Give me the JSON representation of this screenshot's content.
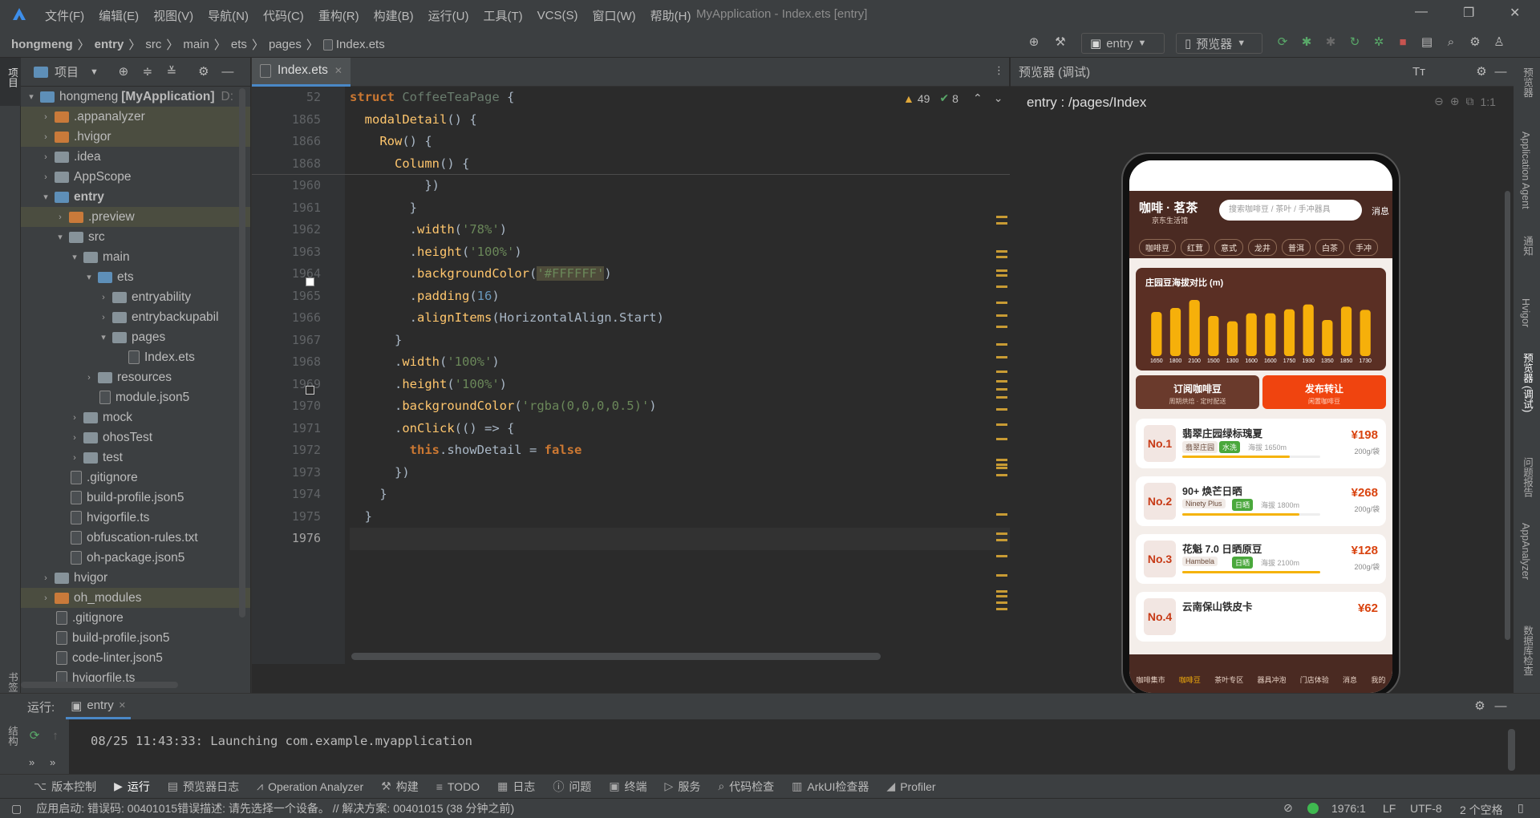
{
  "menu": [
    "文件(F)",
    "编辑(E)",
    "视图(V)",
    "导航(N)",
    "代码(C)",
    "重构(R)",
    "构建(B)",
    "运行(U)",
    "工具(T)",
    "VCS(S)",
    "窗口(W)",
    "帮助(H)"
  ],
  "window_title": "MyApplication - Index.ets [entry]",
  "breadcrumb": [
    "hongmeng",
    "entry",
    "src",
    "main",
    "ets",
    "pages",
    "Index.ets"
  ],
  "toolbar": {
    "run_config": "entry",
    "device": "预览器"
  },
  "project": {
    "header": "项目",
    "items": [
      {
        "label": "hongmeng",
        "suffix": "[MyApplication]",
        "hint": "D:",
        "depth": 0,
        "arrow": "▾",
        "kind": "folder-blue"
      },
      {
        "label": ".appanalyzer",
        "depth": 1,
        "arrow": "›",
        "kind": "folder-orange",
        "sel": true
      },
      {
        "label": ".hvigor",
        "depth": 1,
        "arrow": "›",
        "kind": "folder-orange",
        "sel": true
      },
      {
        "label": ".idea",
        "depth": 1,
        "arrow": "›",
        "kind": "folder"
      },
      {
        "label": "AppScope",
        "depth": 1,
        "arrow": "›",
        "kind": "folder"
      },
      {
        "label": "entry",
        "depth": 1,
        "arrow": "▾",
        "kind": "folder-blue",
        "bold": true
      },
      {
        "label": ".preview",
        "depth": 2,
        "arrow": "›",
        "kind": "folder-orange",
        "sel": true
      },
      {
        "label": "src",
        "depth": 2,
        "arrow": "▾",
        "kind": "folder"
      },
      {
        "label": "main",
        "depth": 3,
        "arrow": "▾",
        "kind": "folder"
      },
      {
        "label": "ets",
        "depth": 4,
        "arrow": "▾",
        "kind": "folder-blue"
      },
      {
        "label": "entryability",
        "depth": 5,
        "arrow": "›",
        "kind": "folder"
      },
      {
        "label": "entrybackupabil",
        "depth": 5,
        "arrow": "›",
        "kind": "folder"
      },
      {
        "label": "pages",
        "depth": 5,
        "arrow": "▾",
        "kind": "folder"
      },
      {
        "label": "Index.ets",
        "depth": 6,
        "arrow": "",
        "kind": "file"
      },
      {
        "label": "resources",
        "depth": 4,
        "arrow": "›",
        "kind": "folder"
      },
      {
        "label": "module.json5",
        "depth": 4,
        "arrow": "",
        "kind": "file"
      },
      {
        "label": "mock",
        "depth": 3,
        "arrow": "›",
        "kind": "folder"
      },
      {
        "label": "ohosTest",
        "depth": 3,
        "arrow": "›",
        "kind": "folder"
      },
      {
        "label": "test",
        "depth": 3,
        "arrow": "›",
        "kind": "folder"
      },
      {
        "label": ".gitignore",
        "depth": 2,
        "arrow": "",
        "kind": "file"
      },
      {
        "label": "build-profile.json5",
        "depth": 2,
        "arrow": "",
        "kind": "file"
      },
      {
        "label": "hvigorfile.ts",
        "depth": 2,
        "arrow": "",
        "kind": "file"
      },
      {
        "label": "obfuscation-rules.txt",
        "depth": 2,
        "arrow": "",
        "kind": "file"
      },
      {
        "label": "oh-package.json5",
        "depth": 2,
        "arrow": "",
        "kind": "file"
      },
      {
        "label": "hvigor",
        "depth": 1,
        "arrow": "›",
        "kind": "folder"
      },
      {
        "label": "oh_modules",
        "depth": 1,
        "arrow": "›",
        "kind": "folder-orange",
        "sel": true
      },
      {
        "label": ".gitignore",
        "depth": 1,
        "arrow": "",
        "kind": "file"
      },
      {
        "label": "build-profile.json5",
        "depth": 1,
        "arrow": "",
        "kind": "file"
      },
      {
        "label": "code-linter.json5",
        "depth": 1,
        "arrow": "",
        "kind": "file"
      },
      {
        "label": "hvigorfile.ts",
        "depth": 1,
        "arrow": "",
        "kind": "file"
      }
    ]
  },
  "editor": {
    "tab": "Index.ets",
    "warnings": "49",
    "checks": "8",
    "sticky_lines": [
      {
        "n": "52",
        "html": "<span class='kw'>struct</span> <span class='gray'>CoffeeTeaPage</span> {"
      },
      {
        "n": "1865",
        "html": "  <span class='fn'>modalDetail</span>() {"
      },
      {
        "n": "1866",
        "html": "    <span class='fn'>Row</span>() {"
      },
      {
        "n": "1868",
        "html": "      <span class='fn'>Column</span>() {"
      }
    ],
    "lines": [
      {
        "n": "1960",
        "html": "          })"
      },
      {
        "n": "1961",
        "html": "        }"
      },
      {
        "n": "1962",
        "html": "        .<span class='fn'>width</span>(<span class='str'>'78%'</span>)"
      },
      {
        "n": "1963",
        "html": "        .<span class='fn'>height</span>(<span class='str'>'100%'</span>)"
      },
      {
        "n": "1964",
        "html": "        .<span class='fn'>backgroundColor</span>(<span class='str' style='background:#4e4b3a'>'#FFFFFF'</span>)"
      },
      {
        "n": "1965",
        "html": "        .<span class='fn'>padding</span>(<span class='num'>16</span>)"
      },
      {
        "n": "1966",
        "html": "        .<span class='fn'>alignItems</span>(HorizontalAlign.Start)"
      },
      {
        "n": "1967",
        "html": "      }"
      },
      {
        "n": "1968",
        "html": "      .<span class='fn'>width</span>(<span class='str'>'100%'</span>)"
      },
      {
        "n": "1969",
        "html": "      .<span class='fn'>height</span>(<span class='str'>'100%'</span>)"
      },
      {
        "n": "1970",
        "html": "      .<span class='fn'>backgroundColor</span>(<span class='str'>'rgba(0,0,0,0.5)'</span>)"
      },
      {
        "n": "1971",
        "html": "      .<span class='fn'>onClick</span>(() => {"
      },
      {
        "n": "1972",
        "html": "        <span class='kw'>this</span>.showDetail = <span class='kw'>false</span>"
      },
      {
        "n": "1973",
        "html": "      })"
      },
      {
        "n": "1974",
        "html": "    }"
      },
      {
        "n": "1975",
        "html": "  }"
      },
      {
        "n": "1976",
        "html": ""
      }
    ]
  },
  "preview": {
    "header": "预览器 (调试)",
    "route": "entry : /pages/Index",
    "zoom_label": "1:1",
    "app": {
      "title": "咖啡 · 茗茶",
      "subtitle": "京东生活馆",
      "search_placeholder": "搜索咖啡豆 / 茶叶 / 手冲器具",
      "msg": "消息",
      "chips": [
        "咖啡豆",
        "红茸",
        "意式",
        "龙井",
        "普洱",
        "白茶",
        "手冲"
      ],
      "chart_title": "庄园豆海拔对比 (m)",
      "bar_labels": [
        "1650",
        "1800",
        "2100",
        "1500",
        "1300",
        "1600",
        "1600",
        "1750",
        "1930",
        "1350",
        "1850",
        "1730"
      ],
      "btn1": "订阅咖啡豆",
      "btn1_sub": "周期烘焙 · 定时配送",
      "btn2": "发布转让",
      "btn2_sub": "闲置咖啡豆",
      "ranks": [
        {
          "no": "No.1",
          "name": "翡翠庄园绿标瑰夏",
          "tag1": "翡翠庄园",
          "tag2": "水洗",
          "alt": "海拔 1650m",
          "price": "¥198",
          "weight": "200g/袋",
          "fill": 0.78
        },
        {
          "no": "No.2",
          "name": "90+ 焕芒日晒",
          "tag1": "Ninety Plus",
          "tag2": "日晒",
          "alt": "海拔 1800m",
          "price": "¥268",
          "weight": "200g/袋",
          "fill": 0.85
        },
        {
          "no": "No.3",
          "name": "花魁 7.0 日晒原豆",
          "tag1": "Hambela",
          "tag2": "日晒",
          "alt": "海拔 2100m",
          "price": "¥128",
          "weight": "200g/袋",
          "fill": 1.0
        },
        {
          "no": "No.4",
          "name": "云南保山铁皮卡",
          "tag1": "",
          "tag2": "",
          "alt": "",
          "price": "¥62",
          "weight": "",
          "fill": 0.6
        }
      ],
      "nav": [
        "咖啡集市",
        "咖啡豆",
        "茶叶专区",
        "器具冲泡",
        "门店体验",
        "消息",
        "我的"
      ]
    }
  },
  "right_strip": [
    "预览器",
    "Application Agent",
    "通知",
    "Hvigor",
    "预览器 (调试)",
    "问题报告",
    "AppAnalyzer",
    "数据库检查"
  ],
  "left_strip": [
    "项目",
    "书签",
    "结构"
  ],
  "run": {
    "label": "运行:",
    "tab": "entry",
    "log": "08/25 11:43:33: Launching com.example.myapplication"
  },
  "bottom_tools": [
    "版本控制",
    "运行",
    "预览器日志",
    "Operation Analyzer",
    "构建",
    "TODO",
    "日志",
    "问题",
    "终端",
    "服务",
    "代码检查",
    "ArkUI检查器",
    "Profiler"
  ],
  "status": {
    "message": "应用启动: 错误码: 00401015错误描述: 请先选择一个设备。 // 解决方案: 00401015 (38 分钟之前)",
    "pos": "1976:1",
    "lf": "LF",
    "enc": "UTF-8",
    "indent": "2 个空格"
  },
  "chart_data": {
    "type": "bar",
    "title": "庄园豆海拔对比 (m)",
    "categories": [
      "1650",
      "1800",
      "2100",
      "1500",
      "1300",
      "1600",
      "1600",
      "1750",
      "1930",
      "1350",
      "1850",
      "1730"
    ],
    "values": [
      1650,
      1800,
      2100,
      1500,
      1300,
      1600,
      1600,
      1750,
      1930,
      1350,
      1850,
      1730
    ],
    "ylim": [
      0,
      2100
    ]
  }
}
